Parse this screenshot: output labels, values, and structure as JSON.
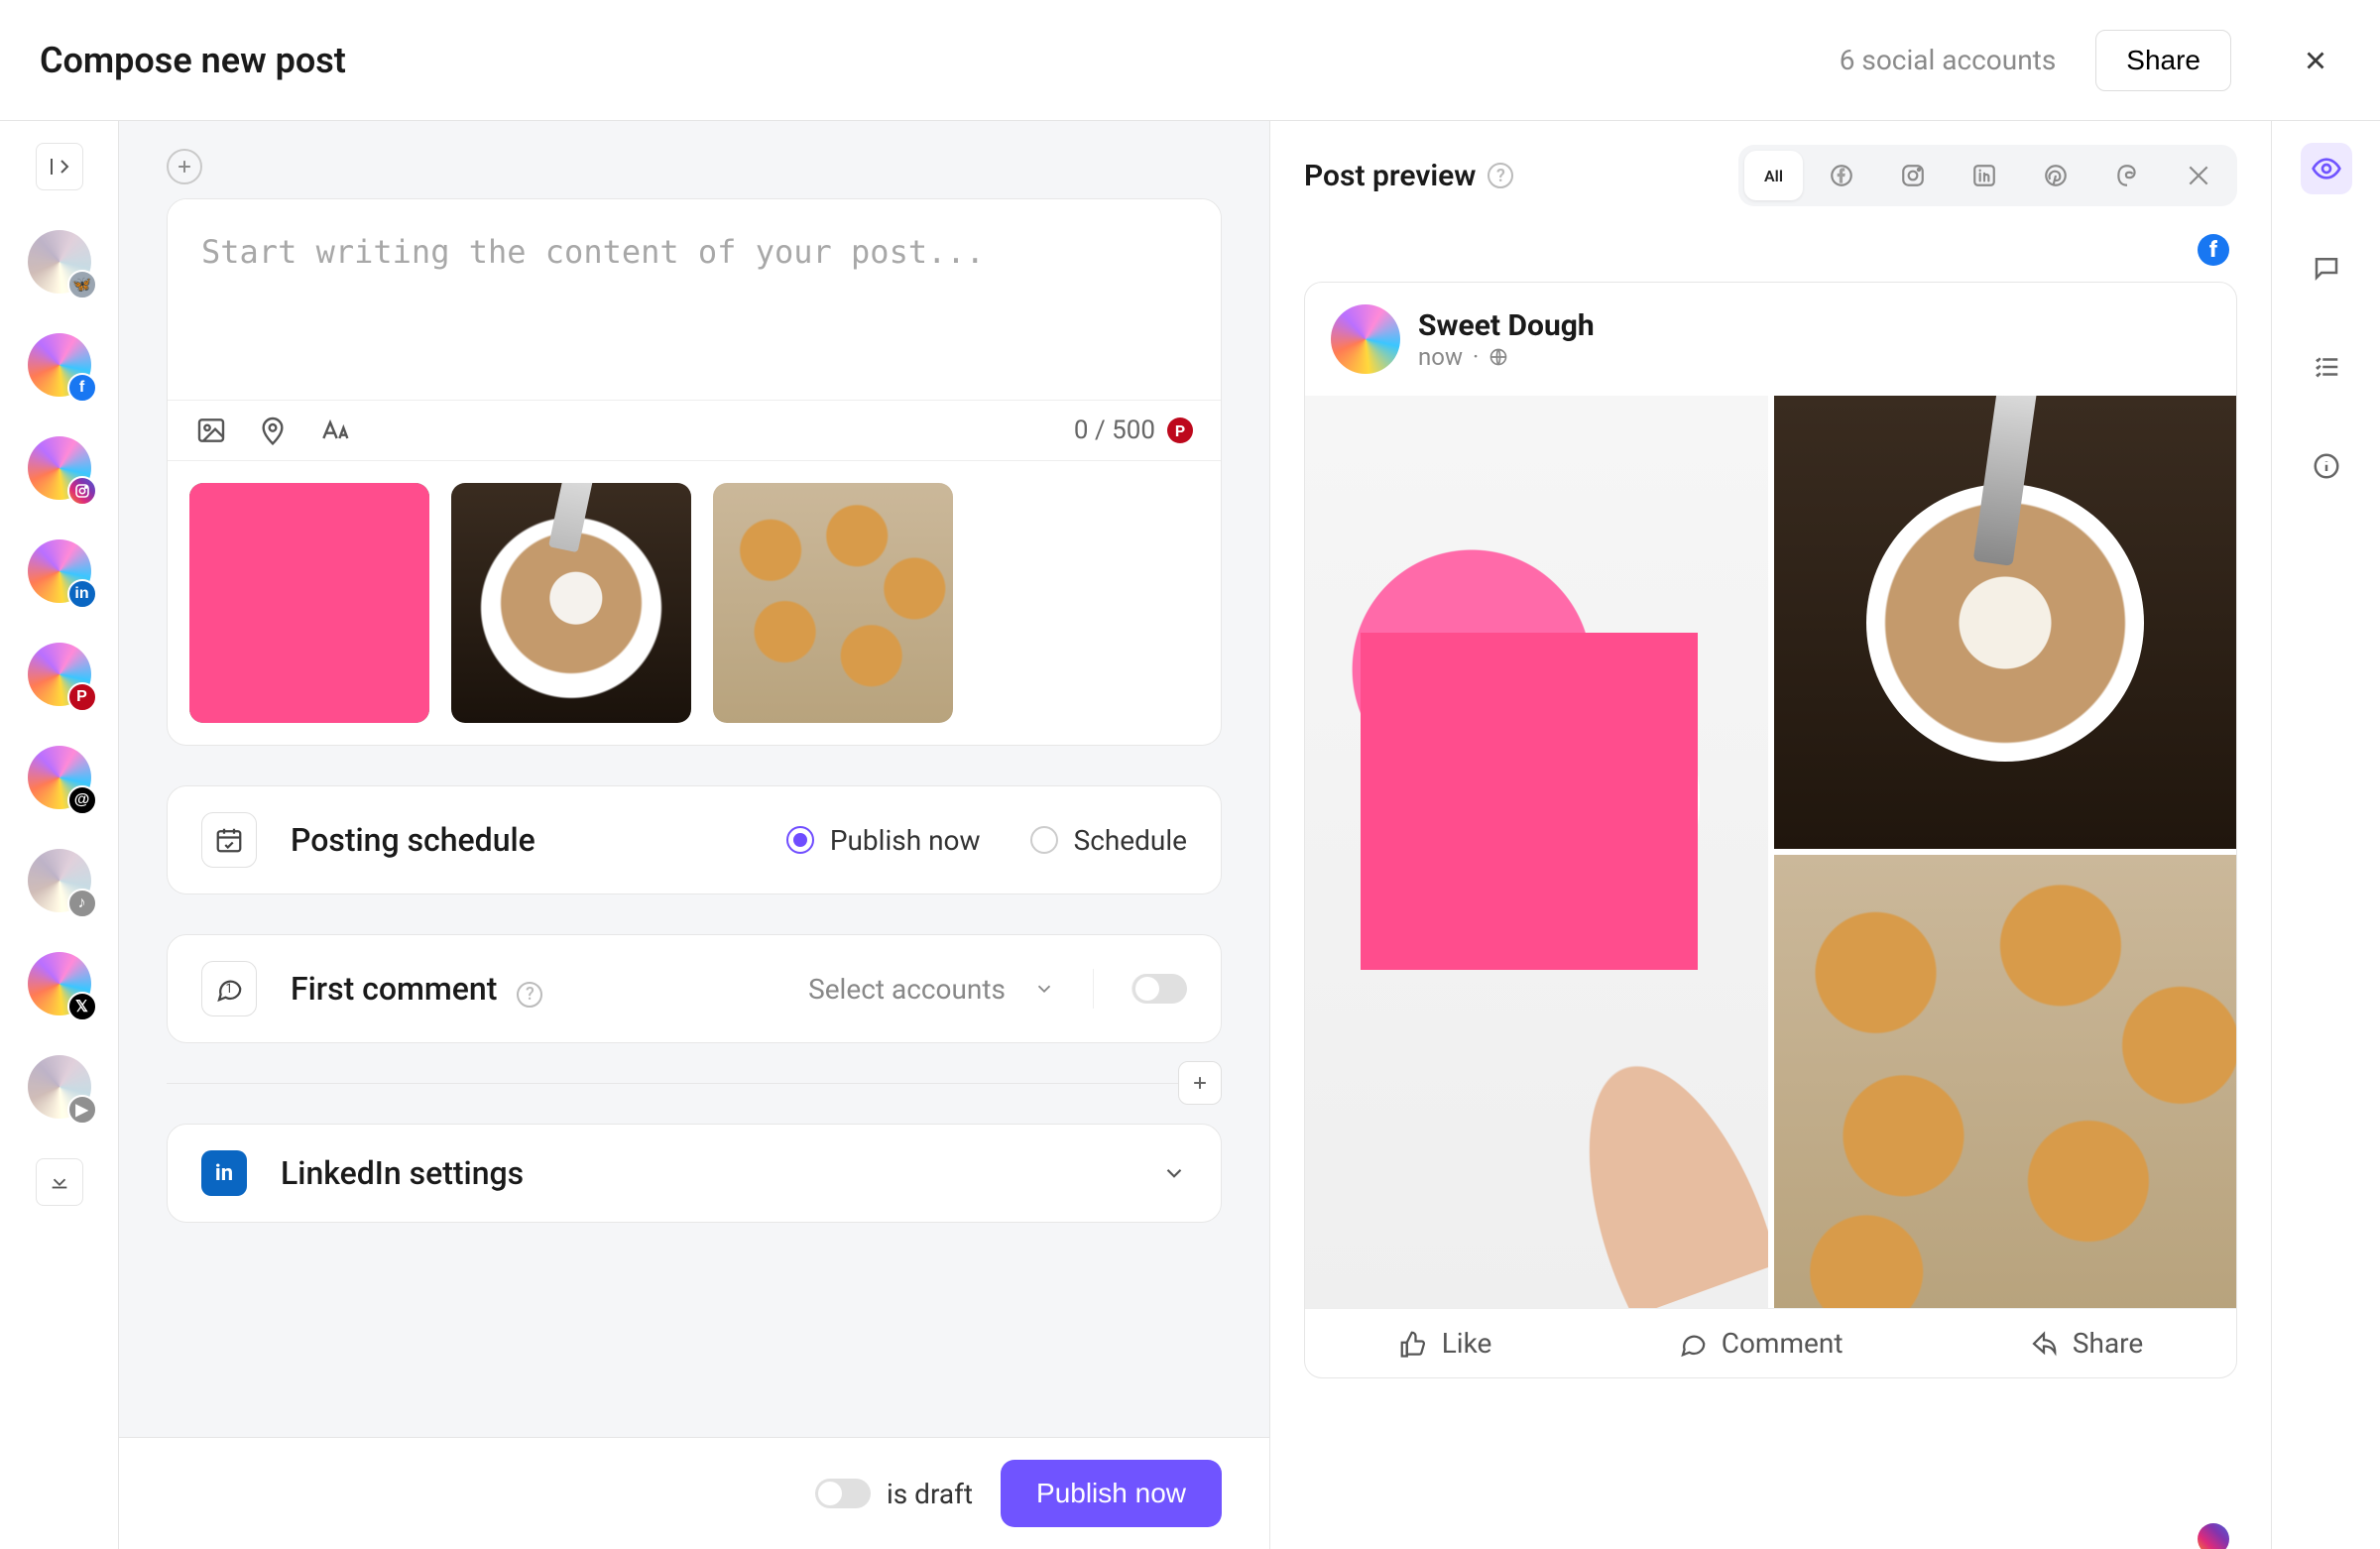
{
  "header": {
    "title": "Compose new post",
    "accounts": "6 social accounts",
    "share": "Share"
  },
  "compose": {
    "placeholder": "Start writing the content of your post...",
    "char_count": "0 / 500"
  },
  "schedule": {
    "title": "Posting schedule",
    "publish_now": "Publish now",
    "schedule": "Schedule"
  },
  "first_comment": {
    "title": "First comment",
    "select": "Select accounts"
  },
  "linkedin": {
    "title": "LinkedIn settings",
    "badge": "in"
  },
  "footer": {
    "draft": "is draft",
    "publish": "Publish now"
  },
  "preview": {
    "title": "Post preview",
    "tabs": {
      "all": "All"
    },
    "post": {
      "name": "Sweet Dough",
      "time": "now"
    },
    "actions": {
      "like": "Like",
      "comment": "Comment",
      "share": "Share"
    }
  },
  "networks": {
    "fb": "f",
    "ig": "ig",
    "li": "in",
    "pin": "P",
    "th": "@",
    "x": "𝕏",
    "yt": "▶"
  }
}
